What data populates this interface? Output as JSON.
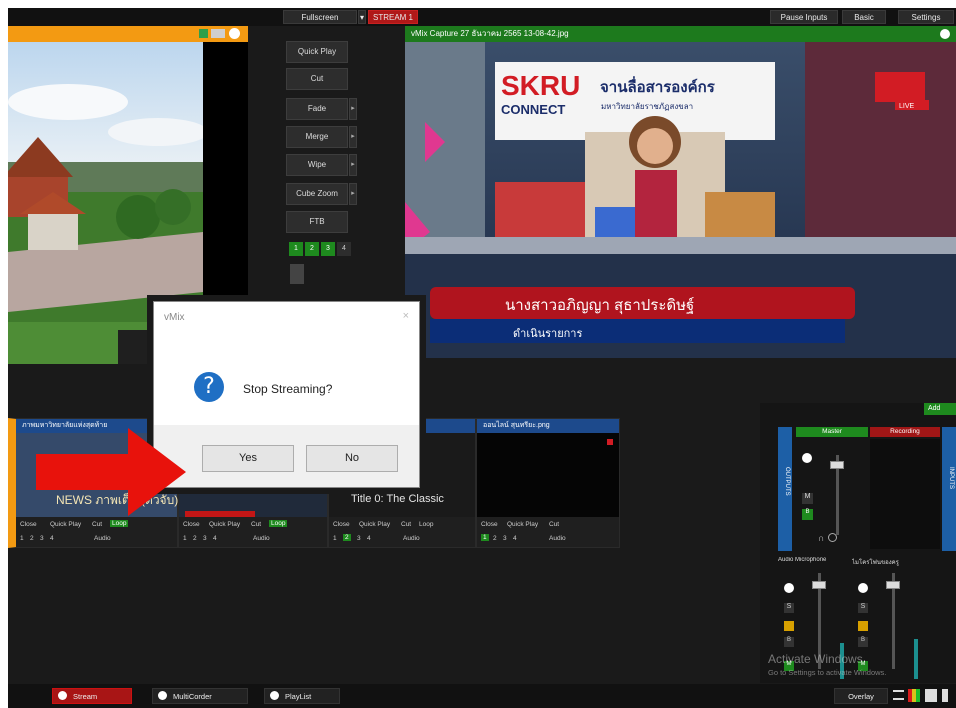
{
  "topbar": {
    "fullscreen": "Fullscreen",
    "stream": "STREAM 1",
    "pause_inputs": "Pause Inputs",
    "basic": "Basic",
    "settings": "Settings"
  },
  "transitions": {
    "buttons": [
      "Quick Play",
      "Cut",
      "Fade",
      "Merge",
      "Wipe",
      "Cube Zoom",
      "FTB"
    ],
    "pages": [
      "1",
      "2",
      "3",
      "4"
    ]
  },
  "output": {
    "title": "vMix Capture 27 ธันวาคม 2565 13-08-42.jpg",
    "logo_skru": "SKRU",
    "logo_connect": "CONNECT",
    "banner_text": "จานลื่อสารองค์กร",
    "banner_sub": "มหาวิทยาลัยราชภัฏสงขลา",
    "live_badge": "LIVE",
    "lower_third_name": "นางสาวอภิญญา  สุธาประดิษฐ์",
    "lower_third_role": "ดำเนินรายการ"
  },
  "inputs": [
    {
      "title": "ภาพมหาวิทยาลัยแห่งสุดท้าย",
      "overlay": "NEWS ภาพเต็ม (ตัวจับ).mp4"
    },
    {
      "title": "",
      "overlay": ""
    },
    {
      "title": "",
      "overlay": "Title 0: The Classic"
    },
    {
      "title": "ออนไลน์ สุนทรียะ.png",
      "overlay": ""
    }
  ],
  "input_controls": {
    "close": "Close",
    "quick_play": "Quick Play",
    "cut": "Cut",
    "loop": "Loop",
    "audio": "Audio",
    "nums": [
      "1",
      "2",
      "3",
      "4"
    ]
  },
  "mixer": {
    "master": "Master",
    "recording": "Recording",
    "outputs": "OUTPUTS",
    "inputs": "INPUTS",
    "ch1": "Audio Microphone",
    "ch2": "ไมโครโฟนของครู",
    "add_label": "Add",
    "m": "M",
    "s": "S",
    "letters": [
      "M",
      "S",
      "B"
    ]
  },
  "dialog": {
    "title": "vMix",
    "close": "×",
    "icon": "?",
    "message": "Stop Streaming?",
    "yes": "Yes",
    "no": "No"
  },
  "bottombar": {
    "stream": "Stream",
    "multicorder": "MultiCorder",
    "playlist": "PlayList",
    "overlay": "Overlay"
  },
  "watermark": {
    "line1": "Activate Windows",
    "line2": "Go to Settings to activate Windows."
  },
  "colors": {
    "preview_header": "#f39a12",
    "output_header": "#1d7a1d",
    "stream_active": "#b01818",
    "input_header": "#1d4a8c",
    "arrow": "#e8120c"
  }
}
